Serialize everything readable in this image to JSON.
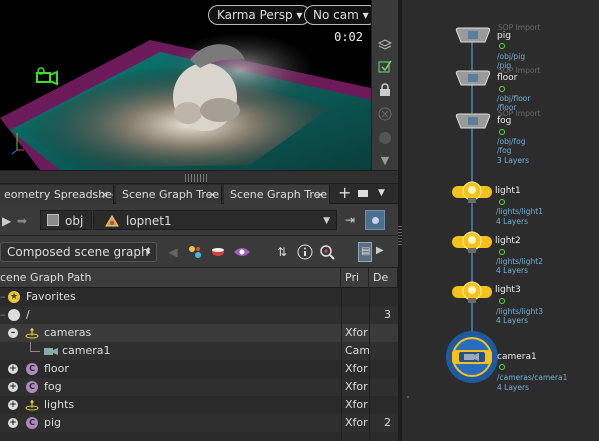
{
  "viewport": {
    "renderer": "Karma Persp",
    "camera": "No cam",
    "timecode": "0:02"
  },
  "tabs": [
    {
      "label": "eometry Spreadsheet"
    },
    {
      "label": "Scene Graph Tree"
    },
    {
      "label": "Scene Graph Tree"
    }
  ],
  "path": {
    "root": "obj",
    "node": "lopnet1"
  },
  "filter": {
    "selected": "Composed scene graph"
  },
  "table": {
    "headers": [
      "cene Graph Path",
      "Pri",
      "De"
    ],
    "rows": [
      {
        "name": "Favorites",
        "prim": "",
        "de": ""
      },
      {
        "name": "/",
        "prim": "",
        "de": "3"
      },
      {
        "name": "cameras",
        "prim": "Xfor",
        "de": ""
      },
      {
        "name": "camera1",
        "prim": "Cam",
        "de": ""
      },
      {
        "name": "floor",
        "prim": "Xfor",
        "de": ""
      },
      {
        "name": "fog",
        "prim": "Xfor",
        "de": ""
      },
      {
        "name": "lights",
        "prim": "Xfor",
        "de": ""
      },
      {
        "name": "pig",
        "prim": "Xfor",
        "de": "2"
      }
    ],
    "icon_letters": {
      "prim": "C"
    }
  },
  "network": {
    "nodes": [
      {
        "name": "pig",
        "comment": "SOP Import",
        "path": "/obj/pig",
        "sub": "/pig",
        "layers": ""
      },
      {
        "name": "floor",
        "comment": "SOP Import",
        "path": "/obj/floor",
        "sub": "/floor",
        "layers": ""
      },
      {
        "name": "fog",
        "comment": "SOP Import",
        "path": "/obj/fog",
        "sub": "/fog",
        "layers": "3 Layers"
      },
      {
        "name": "light1",
        "comment": "",
        "path": "/lights/light1",
        "sub": "",
        "layers": "4 Layers"
      },
      {
        "name": "light2",
        "comment": "",
        "path": "/lights/light2",
        "sub": "",
        "layers": "4 Layers"
      },
      {
        "name": "light3",
        "comment": "",
        "path": "/lights/light3",
        "sub": "",
        "layers": "4 Layers"
      },
      {
        "name": "camera1",
        "comment": "",
        "path": "/cameras/camera1",
        "sub": "",
        "layers": "4 Layers"
      }
    ]
  },
  "colors": {
    "accent_yellow": "#f5c21b",
    "node_path_blue": "#6fb1d6",
    "flag_green": "#5adc3c",
    "wire": "#4b86b5"
  }
}
